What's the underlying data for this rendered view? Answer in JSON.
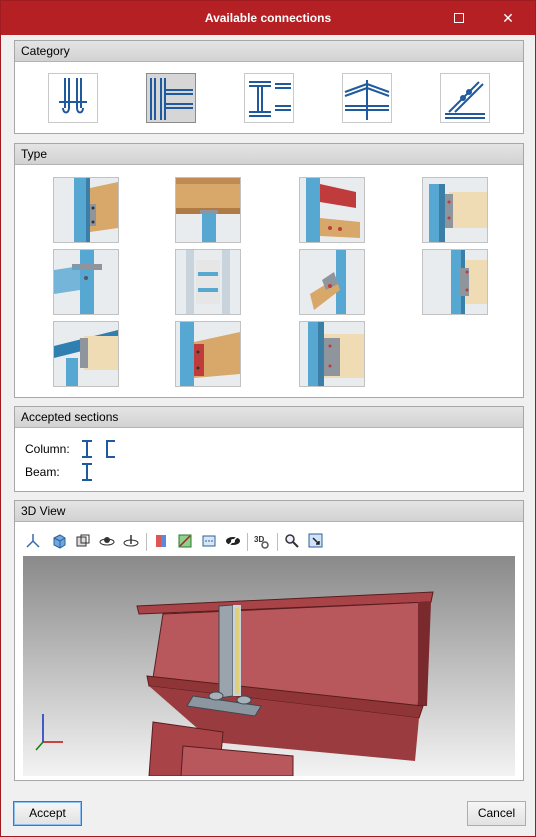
{
  "window": {
    "title": "Available connections",
    "accent": "#b52025"
  },
  "titlebar": {
    "maximize_icon": "maximize-icon",
    "close_icon": "close-icon",
    "close_glyph": "✕"
  },
  "category": {
    "label": "Category",
    "items": [
      {
        "icon": "column-base-icon",
        "selected": false
      },
      {
        "icon": "beam-column-icon",
        "selected": true
      },
      {
        "icon": "beam-beam-icon",
        "selected": false
      },
      {
        "icon": "truss-icon",
        "selected": false
      },
      {
        "icon": "brace-icon",
        "selected": false
      }
    ]
  },
  "type": {
    "label": "Type",
    "count": 11
  },
  "accepted_sections": {
    "label": "Accepted sections",
    "column_label": "Column:",
    "beam_label": "Beam:"
  },
  "view3d": {
    "label": "3D View",
    "tools": [
      "axes-icon",
      "cube-icon",
      "views-icon",
      "orbit-icon",
      "rotate-icon",
      "section-icon",
      "render-icon",
      "measure-icon",
      "hide-icon",
      "3d-settings-icon",
      "zoom-icon",
      "zoom-window-icon"
    ]
  },
  "footer": {
    "accept_label": "Accept",
    "cancel_label": "Cancel"
  }
}
